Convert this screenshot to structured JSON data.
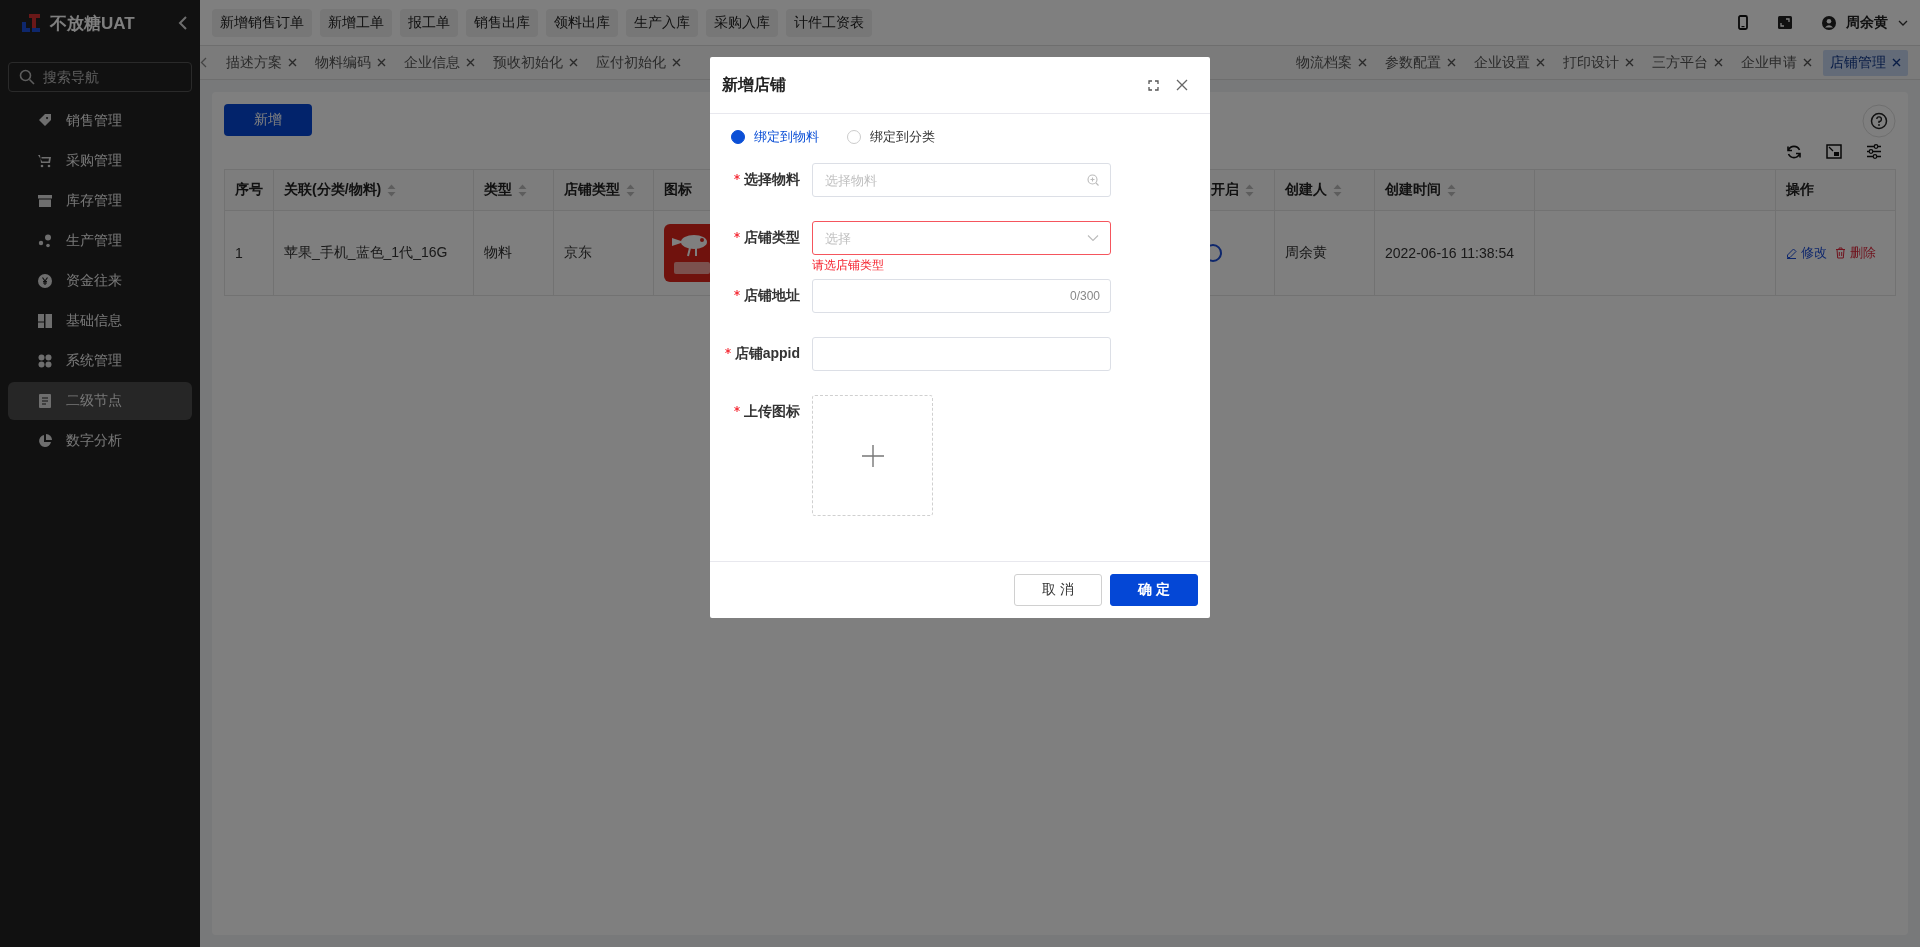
{
  "sidebar": {
    "logo_text": "不放糖UAT",
    "search": {
      "placeholder": "搜索导航"
    },
    "items": [
      {
        "label": "销售管理",
        "selected": false
      },
      {
        "label": "采购管理",
        "selected": false
      },
      {
        "label": "库存管理",
        "selected": false
      },
      {
        "label": "生产管理",
        "selected": false
      },
      {
        "label": "资金往来",
        "selected": false
      },
      {
        "label": "基础信息",
        "selected": false
      },
      {
        "label": "系统管理",
        "selected": false
      },
      {
        "label": "二级节点",
        "selected": true
      },
      {
        "label": "数字分析",
        "selected": false
      }
    ]
  },
  "quick_actions": [
    "新增销售订单",
    "新增工单",
    "报工单",
    "销售出库",
    "领料出库",
    "生产入库",
    "采购入库",
    "计件工资表"
  ],
  "user": {
    "name": "周余黄"
  },
  "tabs": {
    "left": [
      {
        "label": "描述方案",
        "selected": false
      },
      {
        "label": "物料编码",
        "selected": false
      },
      {
        "label": "企业信息",
        "selected": false
      },
      {
        "label": "预收初始化",
        "selected": false
      },
      {
        "label": "应付初始化",
        "selected": false
      }
    ],
    "right": [
      {
        "label": "物流档案",
        "selected": false
      },
      {
        "label": "参数配置",
        "selected": false
      },
      {
        "label": "企业设置",
        "selected": false
      },
      {
        "label": "打印设计",
        "selected": false
      },
      {
        "label": "三方平台",
        "selected": false
      },
      {
        "label": "企业申请",
        "selected": false
      },
      {
        "label": "店铺管理",
        "selected": true
      }
    ]
  },
  "page": {
    "add_button": "新增",
    "table": {
      "columns": [
        {
          "label": "序号",
          "sortable": false
        },
        {
          "label": "关联(分类/物料)",
          "sortable": true
        },
        {
          "label": "类型",
          "sortable": true
        },
        {
          "label": "店铺类型",
          "sortable": true
        },
        {
          "label": "图标",
          "sortable": false
        },
        {
          "label": "开启",
          "sortable": true
        },
        {
          "label": "创建人",
          "sortable": true
        },
        {
          "label": "创建时间",
          "sortable": true
        },
        {
          "sortable": false
        },
        {
          "label": "操作",
          "sortable": false
        }
      ],
      "rows": [
        {
          "index": "1",
          "binding": "苹果_手机_蓝色_1代_16G",
          "type": "物料",
          "store_type": "京东",
          "created_by": "周余黄",
          "created_at": "2022-06-16 11:38:54",
          "actions": [
            {
              "label": "修改",
              "kind": "edit"
            },
            {
              "label": "删除",
              "kind": "delete"
            }
          ]
        }
      ]
    }
  },
  "dialog": {
    "title": "新增店铺",
    "radios": [
      {
        "label": "绑定到物料",
        "selected": true
      },
      {
        "label": "绑定到分类",
        "selected": false
      }
    ],
    "fields": [
      {
        "label": "选择物料",
        "required": true,
        "kind": "search",
        "placeholder": "选择物料"
      },
      {
        "label": "店铺类型",
        "required": true,
        "kind": "select",
        "placeholder": "选择",
        "error": "请选店铺类型"
      },
      {
        "label": "店铺地址",
        "required": true,
        "kind": "text",
        "counter": "0/300"
      },
      {
        "label": "店铺appid",
        "required": true,
        "kind": "text"
      },
      {
        "label": "上传图标",
        "required": true,
        "kind": "upload"
      }
    ],
    "buttons": [
      {
        "label": "取 消",
        "kind": "default"
      },
      {
        "label": "确 定",
        "kind": "primary"
      }
    ]
  }
}
